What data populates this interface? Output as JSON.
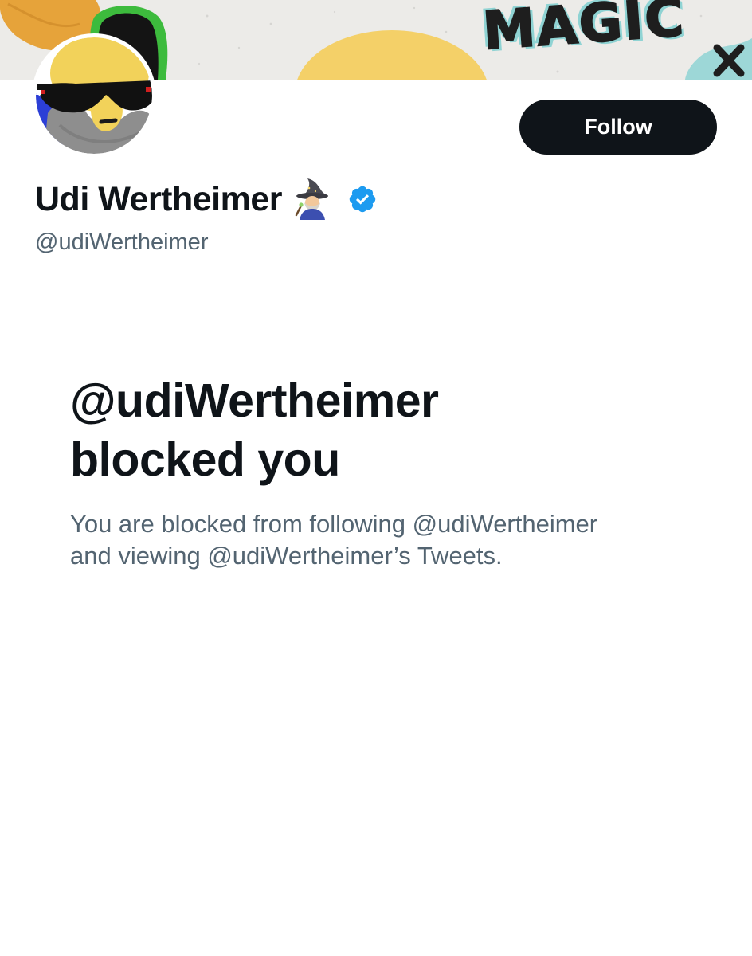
{
  "banner": {
    "text": "MAGIC"
  },
  "profile": {
    "display_name": "Udi Wertheimer",
    "handle": "@udiWertheimer",
    "verified": true,
    "name_emoji": "wizard-icon"
  },
  "follow_button": {
    "label": "Follow"
  },
  "blocked": {
    "title_line1": "@udiWertheimer",
    "title_line2": "blocked you",
    "desc_line1": "You are blocked from following @udiWertheimer",
    "desc_line2": "and viewing @udiWertheimer’s Tweets."
  },
  "colors": {
    "text_primary": "#0f1419",
    "text_secondary": "#536471",
    "button_bg": "#0f1419",
    "verified_blue": "#1d9bf0"
  }
}
